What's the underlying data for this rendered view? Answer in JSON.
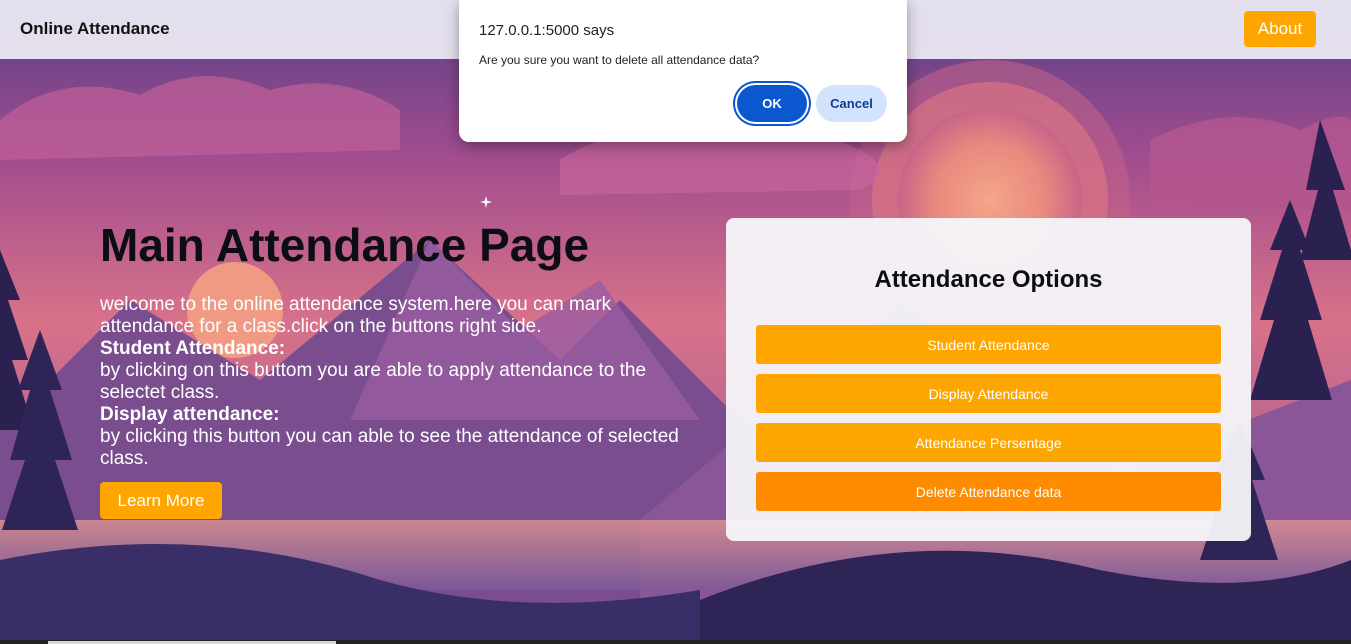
{
  "dialog": {
    "title": "127.0.0.1:5000 says",
    "message": "Are you sure you want to delete all attendance data?",
    "ok_label": "OK",
    "cancel_label": "Cancel"
  },
  "navbar": {
    "brand": "Online Attendance",
    "about_label": "About"
  },
  "hero": {
    "title": "Main Attendance Page",
    "intro": "welcome to the online attendance system.here you can mark attendance for a class.click on the buttons right side.",
    "student_heading": "Student Attendance:",
    "student_text": "by clicking on this buttom you are able to apply attendance to the selectet class.",
    "display_heading": "Display attendance:",
    "display_text": "by clicking this button you can able to see the attendance of selected class.",
    "learn_more_label": "Learn More"
  },
  "options": {
    "title": "Attendance Options",
    "student_label": "Student Attendance",
    "display_label": "Display Attendance",
    "percentage_label": "Attendance Persentage",
    "delete_label": "Delete Attendance data"
  },
  "colors": {
    "accent": "#ffa500",
    "accent_active": "#ff8c00",
    "dialog_primary": "#0b57d0",
    "dialog_secondary": "#d3e3fd"
  }
}
